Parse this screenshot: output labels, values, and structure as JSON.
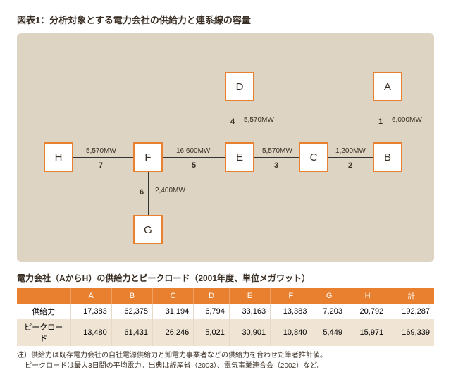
{
  "title": "図表1：分析対象とする電力会社の供給力と連系線の容量",
  "nodes": {
    "A": "A",
    "B": "B",
    "C": "C",
    "D": "D",
    "E": "E",
    "F": "F",
    "G": "G",
    "H": "H"
  },
  "links": {
    "l1": {
      "num": "1",
      "cap": "6,000MW"
    },
    "l2": {
      "num": "2",
      "cap": "1,200MW"
    },
    "l3": {
      "num": "3",
      "cap": "5,570MW"
    },
    "l4": {
      "num": "4",
      "cap": "5,570MW"
    },
    "l5": {
      "num": "5",
      "cap": "16,600MW"
    },
    "l6": {
      "num": "6",
      "cap": "2,400MW"
    },
    "l7": {
      "num": "7",
      "cap": "5,570MW"
    }
  },
  "subtitle": "電力会社（AからH）の供給力とピークロード（2001年度、単位メガワット）",
  "table": {
    "headers": [
      "",
      "A",
      "B",
      "C",
      "D",
      "E",
      "F",
      "G",
      "H",
      "計"
    ],
    "rows": [
      {
        "label": "供給力",
        "vals": [
          "17,383",
          "62,375",
          "31,194",
          "6,794",
          "33,163",
          "13,383",
          "7,203",
          "20,792",
          "192,287"
        ]
      },
      {
        "label": "ピークロード",
        "vals": [
          "13,480",
          "61,431",
          "26,246",
          "5,021",
          "30,901",
          "10,840",
          "5,449",
          "15,971",
          "169,339"
        ]
      }
    ]
  },
  "note_prefix": "注）",
  "note_line1": "供給力は既存電力会社の自社電源供給力と卸電力事業者などの供給力を合わせた筆者推計値。",
  "note_line2": "ピークロードは最大3日間の平均電力。出典は経産省（2003）、電気事業連合会（2002）など。"
}
